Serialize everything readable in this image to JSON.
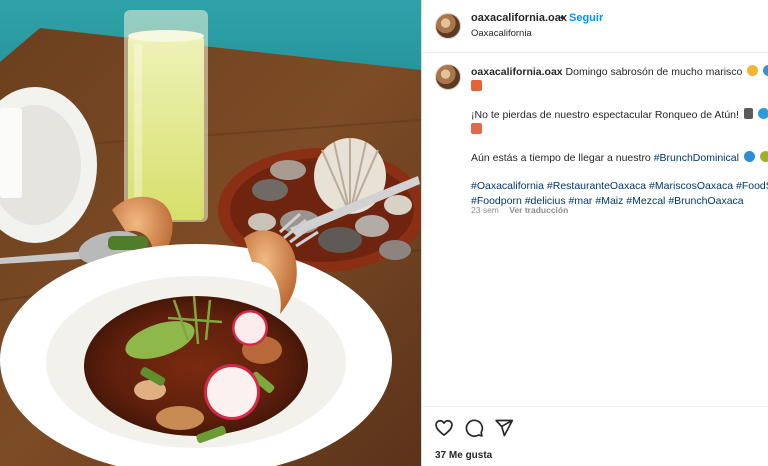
{
  "post": {
    "image_alt": "Bowl of seafood ceviche with shrimp, radish and avocado, glass of juice and plate of shells",
    "header": {
      "username": "oaxacalifornia.oax",
      "separator": "•",
      "follow_label": "Seguir",
      "location": "Oaxacalifornia"
    },
    "caption": {
      "username": "oaxacalifornia.oax",
      "line1": "Domingo sabrosón de mucho marisco",
      "line2": "¡No te pierdas de nuestro espectacular Ronqueo de Atún!",
      "line3": "Aún estás a tiempo de llegar a nuestro",
      "line3_tag": "#BrunchDominical",
      "hashtags_row1": [
        "#Oaxacalifornia",
        "#RestauranteOaxaca",
        "#MariscosOaxaca",
        "#FoodSe"
      ],
      "hashtags_row2": [
        "#Foodporn",
        "#delicius",
        "#mar",
        "#Maiz",
        "#Mezcal",
        "#BrunchOaxaca"
      ]
    },
    "meta": {
      "age": "23 sem",
      "translate_label": "Ver traducción"
    },
    "actions": {
      "icons": [
        "heart-icon",
        "comment-icon",
        "share-icon"
      ],
      "likes_label": "37 Me gusta"
    }
  },
  "colors": {
    "link": "#0095f6",
    "hashtag": "#00376b",
    "muted": "#8e8e8e",
    "text": "#262626"
  }
}
